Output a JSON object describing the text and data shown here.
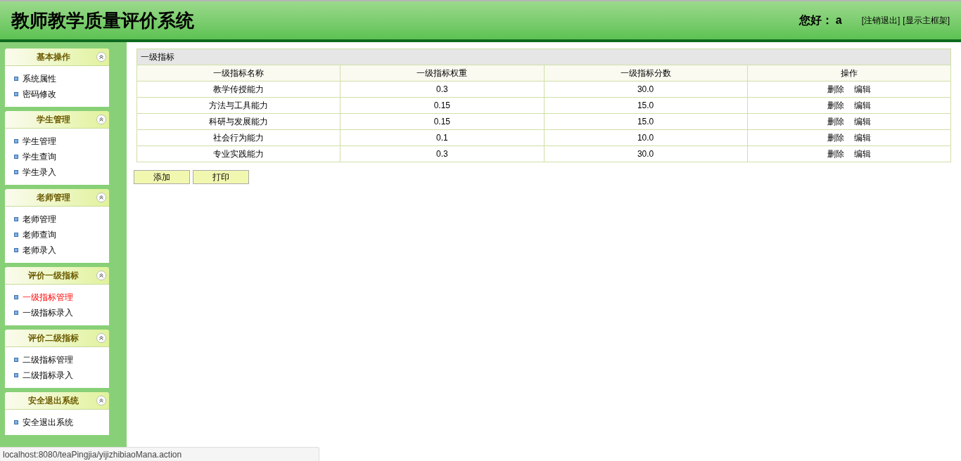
{
  "header": {
    "title": "教师教学质量评价系统",
    "greeting": "您好：",
    "user": "a",
    "links": [
      "[注销退出]",
      "[显示主框架]"
    ]
  },
  "sidebar": {
    "sections": [
      {
        "title": "基本操作",
        "items": [
          {
            "label": "系统属性",
            "selected": false
          },
          {
            "label": "密码修改",
            "selected": false
          }
        ]
      },
      {
        "title": "学生管理",
        "items": [
          {
            "label": "学生管理",
            "selected": false
          },
          {
            "label": "学生查询",
            "selected": false
          },
          {
            "label": "学生录入",
            "selected": false
          }
        ]
      },
      {
        "title": "老师管理",
        "items": [
          {
            "label": "老师管理",
            "selected": false
          },
          {
            "label": "老师查询",
            "selected": false
          },
          {
            "label": "老师录入",
            "selected": false
          }
        ]
      },
      {
        "title": "评价一级指标",
        "items": [
          {
            "label": "一级指标管理",
            "selected": true
          },
          {
            "label": "一级指标录入",
            "selected": false
          }
        ]
      },
      {
        "title": "评价二级指标",
        "items": [
          {
            "label": "二级指标管理",
            "selected": false
          },
          {
            "label": "二级指标录入",
            "selected": false
          }
        ]
      },
      {
        "title": "安全退出系统",
        "items": [
          {
            "label": "安全退出系统",
            "selected": false
          }
        ]
      }
    ]
  },
  "table": {
    "caption": "一级指标",
    "columns": [
      "一级指标名称",
      "一级指标权重",
      "一级指标分数",
      "操作"
    ],
    "rows": [
      {
        "name": "教学传授能力",
        "weight": "0.3",
        "score": "30.0",
        "actions": [
          "删除",
          "编辑"
        ]
      },
      {
        "name": "方法与工具能力",
        "weight": "0.15",
        "score": "15.0",
        "actions": [
          "删除",
          "编辑"
        ]
      },
      {
        "name": "科研与发展能力",
        "weight": "0.15",
        "score": "15.0",
        "actions": [
          "删除",
          "编辑"
        ]
      },
      {
        "name": "社会行为能力",
        "weight": "0.1",
        "score": "10.0",
        "actions": [
          "删除",
          "编辑"
        ]
      },
      {
        "name": "专业实践能力",
        "weight": "0.3",
        "score": "30.0",
        "actions": [
          "删除",
          "编辑"
        ]
      }
    ]
  },
  "buttons": [
    "添加",
    "打印"
  ],
  "status_bar": "localhost:8080/teaPingjia/yijizhibiaoMana.action"
}
